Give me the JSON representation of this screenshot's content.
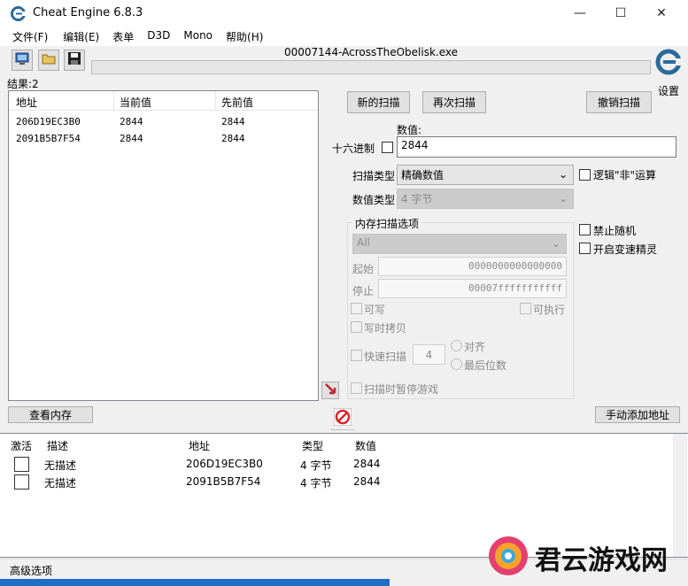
{
  "window": {
    "title": "Cheat Engine 6.8.3",
    "minimize": "—",
    "maximize": "☐",
    "close": "✕"
  },
  "menu": [
    "文件(F)",
    "编辑(E)",
    "表单",
    "D3D",
    "Mono",
    "帮助(H)"
  ],
  "process": {
    "name": "00007144-AcrossTheObelisk.exe"
  },
  "settings_label": "设置",
  "results": {
    "count_label": "结果:2",
    "columns": [
      "地址",
      "当前值",
      "先前值"
    ],
    "rows": [
      {
        "address": "206D19EC3B0",
        "current": "2844",
        "previous": "2844"
      },
      {
        "address": "2091B5B7F54",
        "current": "2844",
        "previous": "2844"
      }
    ]
  },
  "scan": {
    "new_scan": "新的扫描",
    "next_scan": "再次扫描",
    "undo_scan": "撤销扫描",
    "value_label": "数值:",
    "hex_label": "十六进制",
    "value": "2844",
    "scan_type_label": "扫描类型",
    "scan_type": "精确数值",
    "value_type_label": "数值类型",
    "value_type": "4 字节",
    "not_op_label": "逻辑\"非\"运算",
    "no_random_label": "禁止随机",
    "speedhack_label": "开启变速精灵"
  },
  "memory_options": {
    "title": "内存扫描选项",
    "region": "All",
    "start_label": "起始",
    "start": "0000000000000000",
    "stop_label": "停止",
    "stop": "00007fffffffffff",
    "writable": "可写",
    "executable": "可执行",
    "copy_on_write": "写时拷贝",
    "fast_scan": "快速扫描",
    "fast_scan_value": "4",
    "align": "对齐",
    "last_digits": "最后位数",
    "pause_game": "扫描时暂停游戏"
  },
  "buttons": {
    "view_memory": "查看内存",
    "add_address": "手动添加地址"
  },
  "address_list": {
    "columns": [
      "激活",
      "描述",
      "地址",
      "类型",
      "数值"
    ],
    "rows": [
      {
        "description": "无描述",
        "address": "206D19EC3B0",
        "type": "4 字节",
        "value": "2844"
      },
      {
        "description": "无描述",
        "address": "2091B5B7F54",
        "type": "4 字节",
        "value": "2844"
      }
    ]
  },
  "footer": {
    "advanced": "高级选项"
  },
  "watermark": {
    "text": "君云游戏网"
  },
  "colors": {
    "window_bg": "#f0f0f0",
    "list_bg": "#ffffff",
    "border": "#828790",
    "logo_blue": "#2b6a9c",
    "stop_red": "#d9272e"
  }
}
